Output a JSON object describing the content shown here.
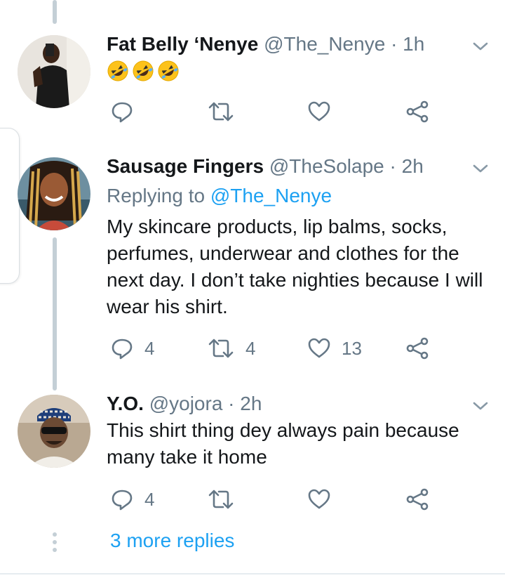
{
  "colors": {
    "accent": "#1da1f2",
    "secondary_text": "#657786",
    "primary_text": "#14171a",
    "thread_line": "#c4cfd6"
  },
  "tweets": [
    {
      "name": "Fat Belly ‘Nenye",
      "handle": "@The_Nenye",
      "time": "· 1h",
      "emoji": [
        "rolling-on-floor-laughing",
        "rolling-on-floor-laughing",
        "rolling-on-floor-laughing"
      ],
      "reply_count": "",
      "retweet_count": "",
      "like_count": ""
    },
    {
      "name": "Sausage Fingers",
      "handle": "@TheSolape",
      "time": "· 2h",
      "replying_label": "Replying to",
      "replying_to": "@The_Nenye",
      "text": "My skincare products, lip balms, socks, perfumes, underwear and clothes for the next day. I don’t take nighties because I will wear his shirt.",
      "reply_count": "4",
      "retweet_count": "4",
      "like_count": "13"
    },
    {
      "name": "Y.O.",
      "handle": "@yojora",
      "time": "· 2h",
      "text": "This shirt thing dey always pain because many take it home",
      "reply_count": "4",
      "retweet_count": "",
      "like_count": ""
    }
  ],
  "more_replies": "3 more replies"
}
